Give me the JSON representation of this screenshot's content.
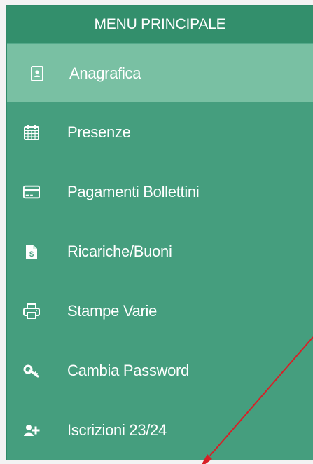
{
  "menu": {
    "header": "MENU PRINCIPALE",
    "items": [
      {
        "label": "Anagrafica",
        "icon": "profile-card-icon",
        "active": true
      },
      {
        "label": "Presenze",
        "icon": "calendar-icon"
      },
      {
        "label": "Pagamenti Bollettini",
        "icon": "credit-card-icon"
      },
      {
        "label": "Ricariche/Buoni",
        "icon": "dollar-document-icon"
      },
      {
        "label": "Stampe Varie",
        "icon": "printer-icon"
      },
      {
        "label": "Cambia Password",
        "icon": "key-icon"
      },
      {
        "label": "Iscrizioni 23/24",
        "icon": "add-user-icon"
      }
    ]
  },
  "colors": {
    "menu_bg": "#459e7e",
    "header_bg": "#338f6c",
    "active_bg": "#79c0a3",
    "text": "#ffffff",
    "annotation_arrow": "#d81f26"
  }
}
